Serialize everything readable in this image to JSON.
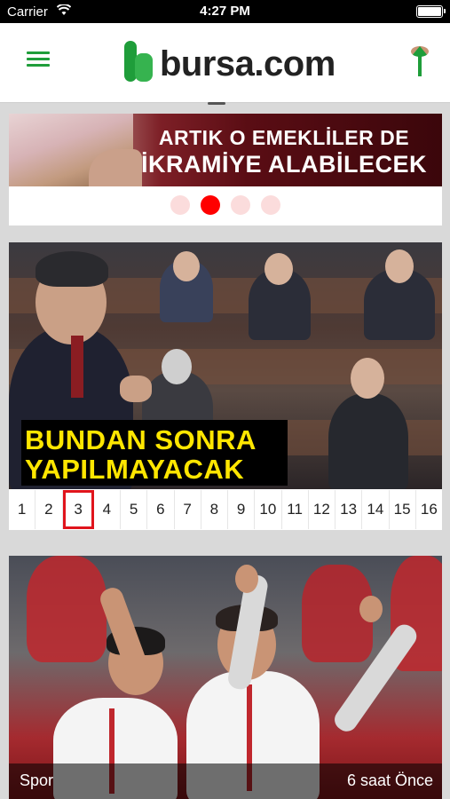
{
  "status_bar": {
    "carrier": "Carrier",
    "time": "4:27 PM"
  },
  "header": {
    "logo_text": "bursa.com",
    "menu_icon": "hamburger-menu-icon",
    "up_icon": "arrow-up-icon",
    "accent_color": "#1f9d3a"
  },
  "banner": {
    "line1": "ARTIK O EMEKLİLER DE",
    "line2": "İKRAMİYE ALABİLECEK",
    "dots_count": 4,
    "active_dot": 2
  },
  "news": {
    "headline_line1": "BUNDAN SONRA",
    "headline_line2": "YAPILMAYACAK",
    "pages": [
      "1",
      "2",
      "3",
      "4",
      "5",
      "6",
      "7",
      "8",
      "9",
      "10",
      "11",
      "12",
      "13",
      "14",
      "15",
      "16"
    ],
    "active_page": "3"
  },
  "sport": {
    "category": "Spor",
    "time_ago": "6 saat Önce"
  }
}
